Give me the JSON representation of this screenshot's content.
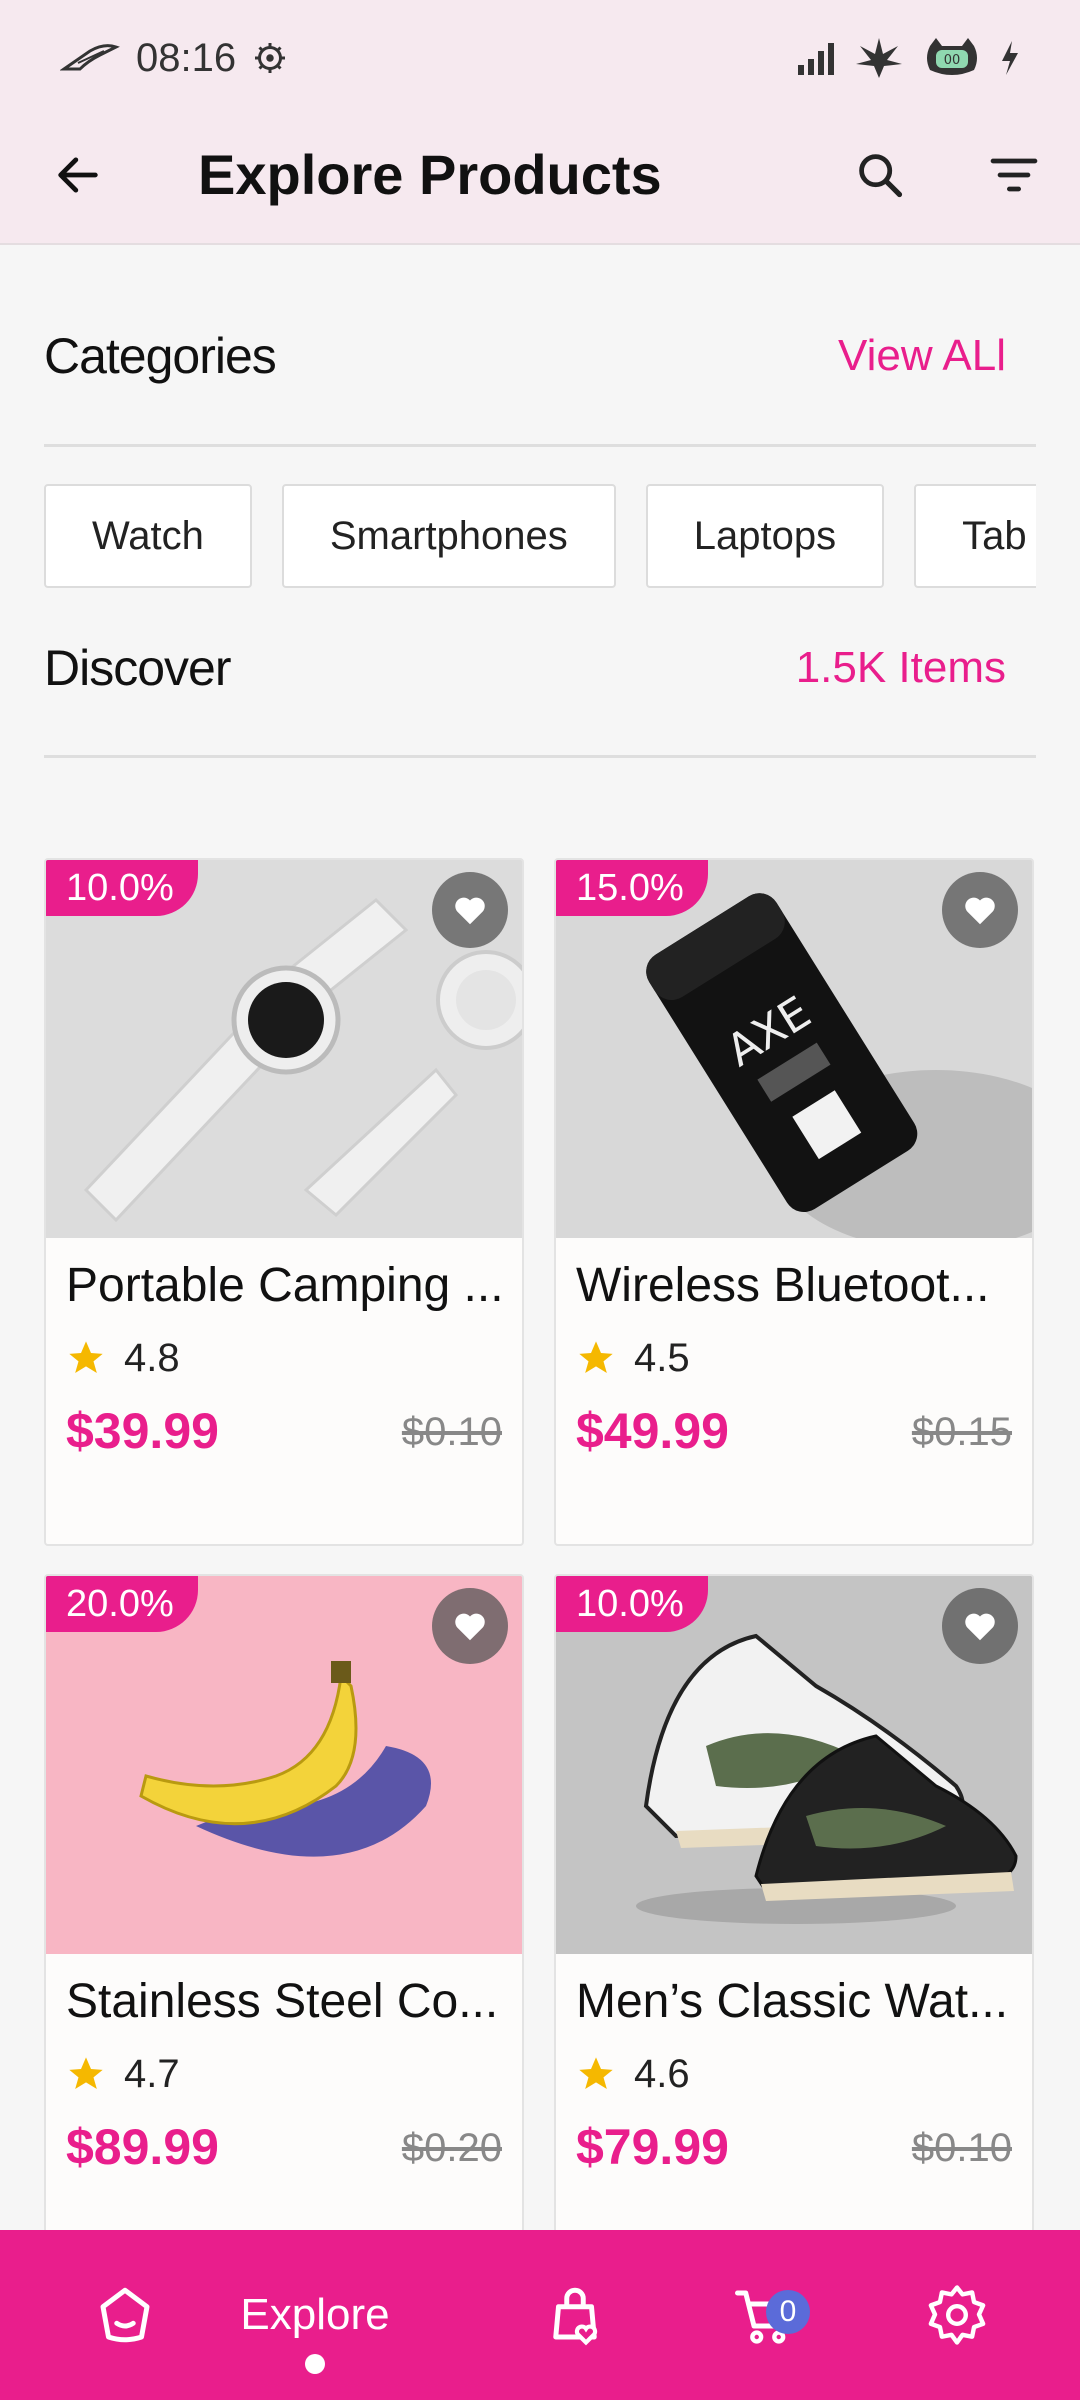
{
  "status_bar": {
    "time": "08:16"
  },
  "app_bar": {
    "title": "Explore Products"
  },
  "categories": {
    "title": "Categories",
    "view_all": "View ALl",
    "chips": [
      "Watch",
      "Smartphones",
      "Laptops",
      "Tab"
    ]
  },
  "discover": {
    "title": "Discover",
    "count": "1.5K Items"
  },
  "products": [
    {
      "name": "Portable Camping ...",
      "rating": "4.8",
      "price": "$39.99",
      "old_price": "$0.10",
      "discount": "10.0%"
    },
    {
      "name": "Wireless Bluetoot...",
      "rating": "4.5",
      "price": "$49.99",
      "old_price": "$0.15",
      "discount": "15.0%"
    },
    {
      "name": "Stainless Steel Co...",
      "rating": "4.7",
      "price": "$89.99",
      "old_price": "$0.20",
      "discount": "20.0%"
    },
    {
      "name": "Men’s Classic Wat...",
      "rating": "4.6",
      "price": "$79.99",
      "old_price": "$0.10",
      "discount": "10.0%"
    }
  ],
  "bottom_nav": {
    "active_label": "Explore",
    "cart_count": "0"
  },
  "colors": {
    "accent": "#e91e8c",
    "header_bg": "#f6e9ef",
    "badge_blue": "#5b6bd9",
    "star": "#f5b800"
  }
}
